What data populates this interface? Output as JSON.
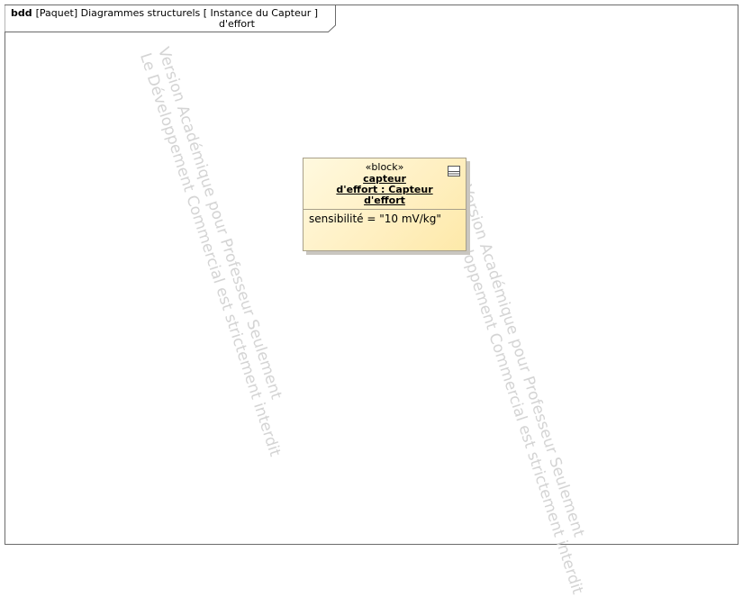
{
  "frame": {
    "kind": "bdd",
    "line1": "[Paquet] Diagrammes structurels [ Instance du Capteur ]",
    "line2": "d'effort"
  },
  "block": {
    "stereotype": "«block»",
    "name_lines": [
      "capteur",
      "d'effort : Capteur",
      "d'effort"
    ],
    "attribute": "sensibilité = \"10 mV/kg\""
  },
  "watermarks": [
    {
      "line1": "Version Académique pour Professeur Seulement",
      "line2": "Le Développement Commercial est strictement interdit"
    },
    {
      "line1": "Version Académique pour Professeur Seulement",
      "line2": "Le Développement Commercial est strictement interdit"
    }
  ],
  "colors": {
    "block_fill": "#ffefc0",
    "block_border": "#a8a08a",
    "watermark": "#d4d4d4"
  }
}
